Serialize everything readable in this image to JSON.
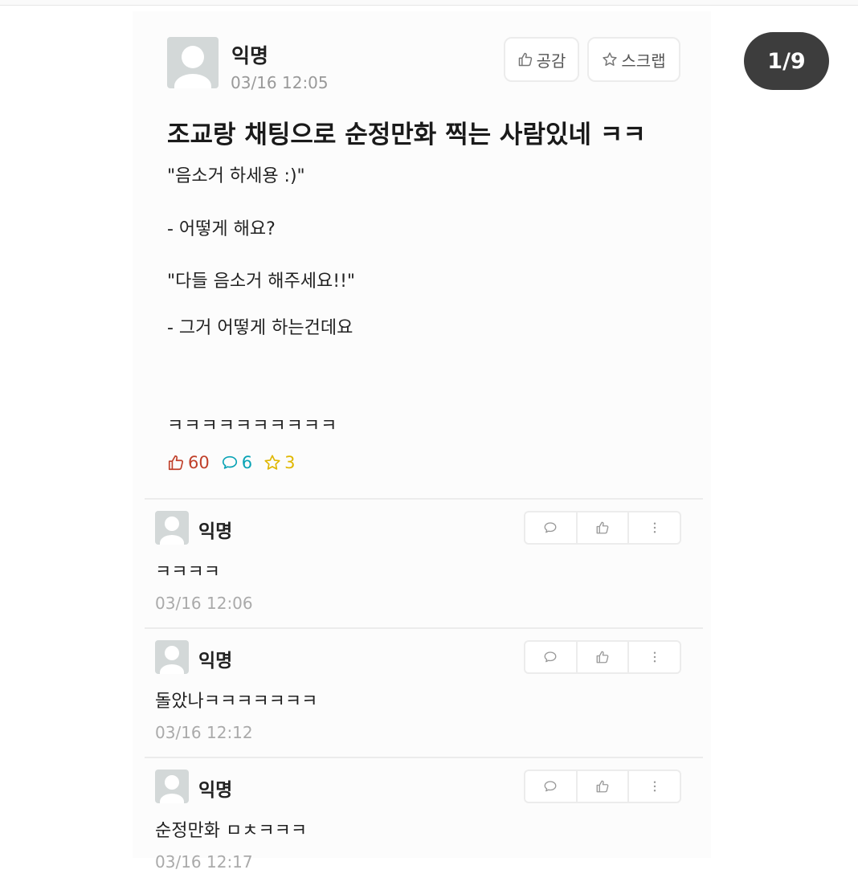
{
  "post": {
    "author": "익명",
    "time": "03/16 12:05",
    "like_label": "공감",
    "scrap_label": "스크랩",
    "title": "조교랑 채팅으로 순정만화 찍는 사람있네 ㅋㅋ",
    "body_lines": [
      "\"음소거 하세용 :)\"",
      "- 어떻게 해요?",
      "\"다들 음소거 해주세요!!\"",
      "- 그거 어떻게 하는건데요",
      "ㅋㅋㅋㅋㅋㅋㅋㅋㅋㅋ"
    ],
    "stats": {
      "likes": "60",
      "comments": "6",
      "scraps": "3"
    }
  },
  "comments": [
    {
      "author": "익명",
      "text": "ㅋㅋㅋㅋ",
      "time": "03/16 12:06"
    },
    {
      "author": "익명",
      "text": "돌았나ㅋㅋㅋㅋㅋㅋㅋ",
      "time": "03/16 12:12"
    },
    {
      "author": "익명",
      "text": "순정만화 ㅁㅊㅋㅋㅋ",
      "time": "03/16 12:17"
    }
  ],
  "page_indicator": "1/9",
  "colors": {
    "like": "#c0402a",
    "comment": "#0aa3b5",
    "scrap": "#e0b700",
    "badge_bg": "#3d3d3d"
  },
  "icons": {
    "like": "thumbs-up-icon",
    "scrap": "star-icon",
    "comment": "speech-bubble-icon",
    "more": "more-vertical-icon"
  }
}
